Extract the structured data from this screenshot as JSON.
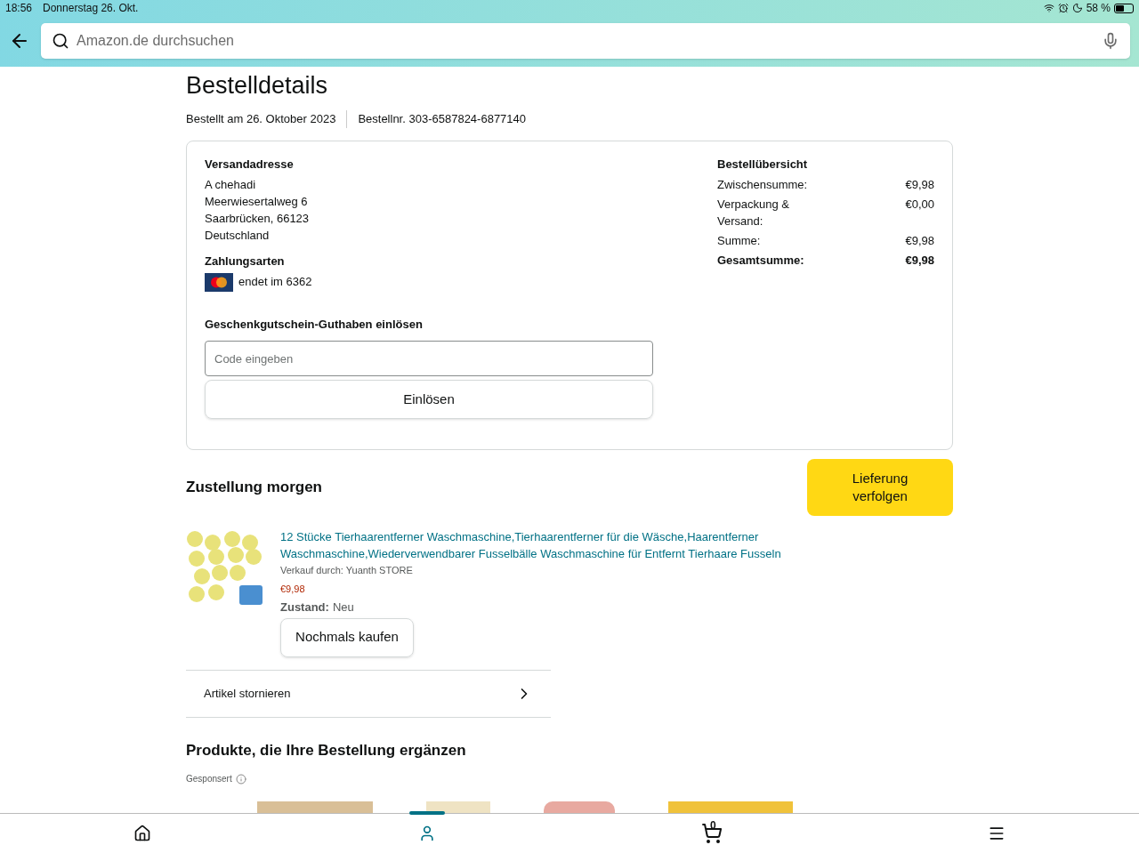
{
  "status_bar": {
    "time": "18:56",
    "date": "Donnerstag 26. Okt.",
    "battery": "58 %"
  },
  "search": {
    "placeholder": "Amazon.de durchsuchen"
  },
  "title": "Bestelldetails",
  "order_meta": [
    "Bestellt am 26. Oktober 2023",
    "Bestellnr. 303-6587824-6877140"
  ],
  "shipping": {
    "heading": "Versandadresse",
    "lines": [
      "A chehadi",
      "Meerwiesertalweg 6",
      "Saarbrücken, 66123",
      "Deutschland"
    ]
  },
  "payment": {
    "heading": "Zahlungsarten",
    "card": "endet im 6362"
  },
  "gift_card": {
    "heading": "Geschenkgutschein-Guthaben einlösen",
    "placeholder": "Code eingeben",
    "button": "Einlösen"
  },
  "summary": {
    "heading": "Bestellübersicht",
    "rows": [
      {
        "label": "Zwischensumme:",
        "value": "€9,98",
        "bold": false
      },
      {
        "label": "Verpackung & Versand:",
        "value": "€0,00",
        "bold": false
      },
      {
        "label": "Summe:",
        "value": "€9,98",
        "bold": false
      },
      {
        "label": "Gesamtsumme:",
        "value": "€9,98",
        "bold": true
      }
    ]
  },
  "delivery": {
    "heading": "Zustellung morgen",
    "track_button": "Lieferung verfolgen"
  },
  "item": {
    "title": "12 Stücke Tierhaarentferner Waschmaschine,Tierhaarentferner für die Wäsche,Haarentferner Waschmaschine,Wiederverwendbarer Fusselbälle Waschmaschine für Entfernt Tierhaare Fusseln",
    "seller": "Verkauf durch: Yuanth STORE",
    "price": "€9,98",
    "condition_label": "Zustand:",
    "condition": "Neu",
    "buy_again": "Nochmals kaufen"
  },
  "cancel_row": "Artikel stornieren",
  "recommendations": {
    "heading": "Produkte, die Ihre Bestellung ergänzen",
    "sponsored": "Gesponsert"
  },
  "bottom_nav": [
    {
      "kind": "home",
      "selected": false
    },
    {
      "kind": "account",
      "selected": true
    },
    {
      "kind": "cart",
      "selected": false,
      "count": "0"
    },
    {
      "kind": "menu",
      "selected": false
    }
  ]
}
